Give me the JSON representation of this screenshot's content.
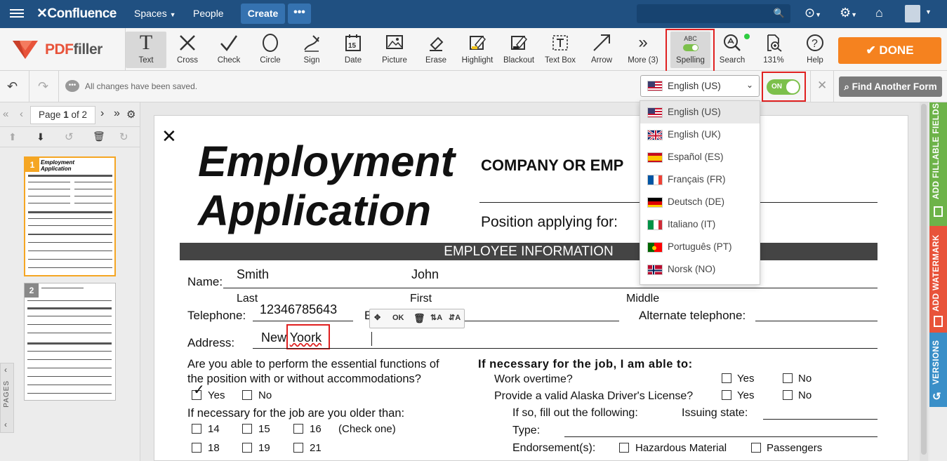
{
  "confluence": {
    "logo": "Confluence",
    "nav": [
      "Spaces",
      "People"
    ],
    "create": "Create",
    "more": "•••"
  },
  "toolbar": {
    "brand_pdf": "PDF",
    "brand_filler": "filler",
    "tools": [
      {
        "label": "Text",
        "icon": "text-icon",
        "glyph": "T"
      },
      {
        "label": "Cross",
        "icon": "cross-icon",
        "glyph": "✕"
      },
      {
        "label": "Check",
        "icon": "check-icon",
        "glyph": "✓"
      },
      {
        "label": "Circle",
        "icon": "circle-icon",
        "glyph": "○"
      },
      {
        "label": "Sign",
        "icon": "sign-icon",
        "glyph": "✍"
      },
      {
        "label": "Date",
        "icon": "date-icon",
        "glyph": "15"
      },
      {
        "label": "Picture",
        "icon": "picture-icon",
        "glyph": "▨"
      },
      {
        "label": "Erase",
        "icon": "erase-icon",
        "glyph": "✎"
      },
      {
        "label": "Highlight",
        "icon": "highlight-icon",
        "glyph": "✎"
      },
      {
        "label": "Blackout",
        "icon": "blackout-icon",
        "glyph": "✎"
      },
      {
        "label": "Text Box",
        "icon": "textbox-icon",
        "glyph": "T"
      },
      {
        "label": "Arrow",
        "icon": "arrow-icon",
        "glyph": "↗"
      },
      {
        "label": "More (3)",
        "icon": "more-icon",
        "glyph": "»"
      },
      {
        "label": "Spelling",
        "icon": "spelling-icon",
        "glyph": "ABC"
      },
      {
        "label": "Search",
        "icon": "search-icon",
        "glyph": "⌕"
      },
      {
        "label": "131%",
        "icon": "zoom-icon",
        "glyph": "⊕"
      },
      {
        "label": "Help",
        "icon": "help-icon",
        "glyph": "?"
      }
    ],
    "done": "DONE"
  },
  "bar2": {
    "saved": "All changes have been saved.",
    "language": "English (US)",
    "toggle": "ON",
    "find": "Find Another Form"
  },
  "pager": {
    "label": "Page ",
    "current": "1",
    "of": " of 2"
  },
  "languages": [
    {
      "label": "English (US)",
      "flag": "us"
    },
    {
      "label": "English (UK)",
      "flag": "uk"
    },
    {
      "label": "Español (ES)",
      "flag": "es"
    },
    {
      "label": "Français (FR)",
      "flag": "fr"
    },
    {
      "label": "Deutsch (DE)",
      "flag": "de"
    },
    {
      "label": "Italiano (IT)",
      "flag": "it"
    },
    {
      "label": "Português (PT)",
      "flag": "pt"
    },
    {
      "label": "Norsk (NO)",
      "flag": "no"
    }
  ],
  "side_tabs": {
    "fillable": "ADD FILLABLE FIELDS",
    "watermark": "ADD WATERMARK",
    "versions": "VERSIONS",
    "pages": "PAGES"
  },
  "thumbs": [
    {
      "num": "1",
      "title": "Employment Application"
    },
    {
      "num": "2"
    }
  ],
  "doc": {
    "title1": "Employment",
    "title2": "Application",
    "company": "COMPANY OR EMP",
    "position": "Position applying for:",
    "section": "EMPLOYEE INFORMATION",
    "name_label": "Name:",
    "last_value": "Smith",
    "first_value": "John",
    "last": "Last",
    "first": "First",
    "middle": "Middle",
    "telephone": "Telephone:",
    "tel_value": "12346785643",
    "alt_tel": "Alternate telephone:",
    "e_label": "E",
    "address": "Address:",
    "addr_value1": "New ",
    "addr_value2": "Yoork",
    "ok": "OK",
    "q1a": "Are you able to perform the essential functions of",
    "q1b": "the position with or without accommodations?",
    "yes": "Yes",
    "no": "No",
    "q2": "If necessary for the job are you older than:",
    "ages": [
      "14",
      "15",
      "16",
      "18",
      "19",
      "21"
    ],
    "checkone": "(Check one)",
    "r_head": "If necessary for the job, I am able to:",
    "overtime": "Work overtime?",
    "license": "Provide a valid Alaska Driver's License?",
    "iffill": "If so, fill out the following:",
    "issuing": "Issuing state:",
    "type": "Type:",
    "endorse": "Endorsement(s):",
    "hazmat": "Hazardous Material",
    "passengers": "Passengers"
  }
}
